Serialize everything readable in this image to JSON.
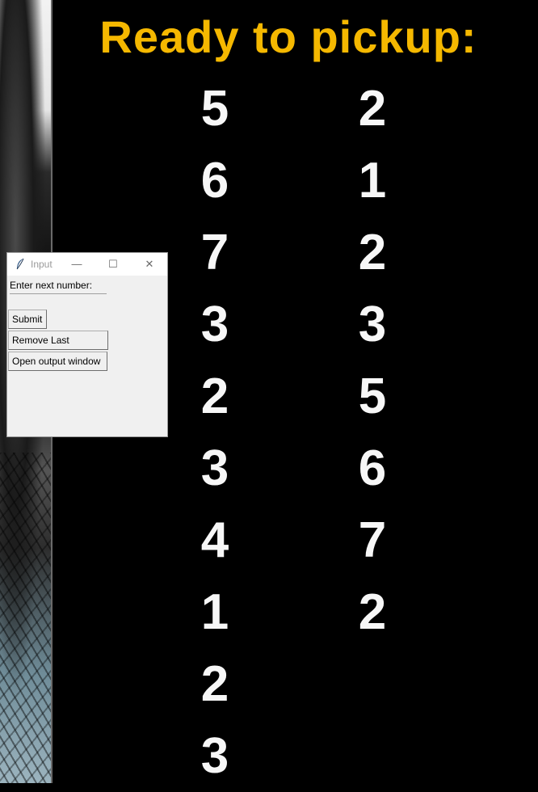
{
  "display": {
    "title": "Ready to pickup:",
    "left_column": [
      "5",
      "6",
      "7",
      "3",
      "2",
      "3",
      "4",
      "1",
      "2",
      "3"
    ],
    "right_column": [
      "2",
      "1",
      "2",
      "3",
      "5",
      "6",
      "7",
      "2"
    ],
    "colors": {
      "title": "#f5b800",
      "numbers": "#f7f7f7",
      "background": "#000000"
    }
  },
  "input_window": {
    "title": "Input",
    "app_icon": "feather-icon",
    "controls": {
      "minimize": "—",
      "maximize": "☐",
      "close": "✕"
    },
    "entry_label": "Enter next number:",
    "entry_value": "",
    "buttons": {
      "submit": "Submit",
      "remove_last": "Remove Last Number",
      "open_output": "Open output window"
    }
  }
}
